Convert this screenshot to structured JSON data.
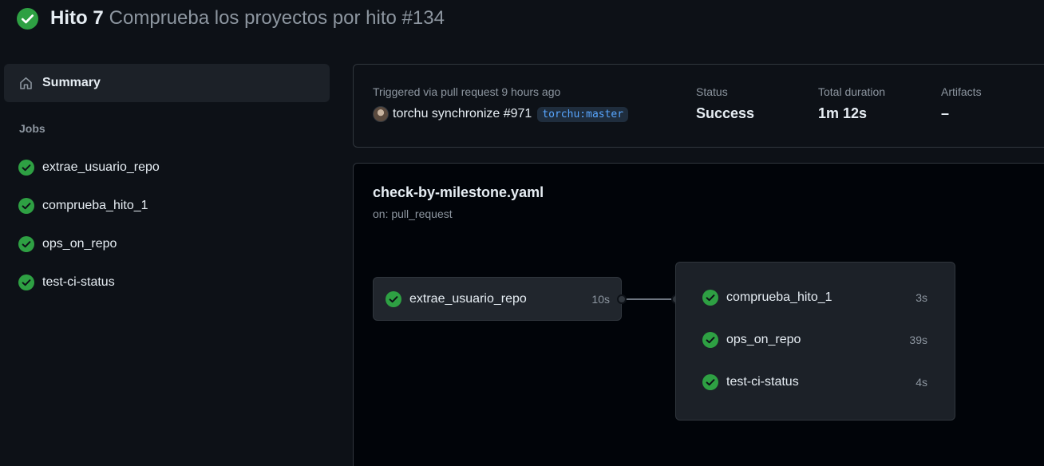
{
  "header": {
    "run_name": "Hito 7",
    "run_subtitle": "Comprueba los proyectos por hito #134",
    "status_icon": "check-circle-fill-icon",
    "success_color": "#2ea043"
  },
  "sidebar": {
    "summary_label": "Summary",
    "summary_icon": "home-icon",
    "jobs_heading": "Jobs",
    "jobs": [
      {
        "label": "extrae_usuario_repo",
        "status": "success"
      },
      {
        "label": "comprueba_hito_1",
        "status": "success"
      },
      {
        "label": "ops_on_repo",
        "status": "success"
      },
      {
        "label": "test-ci-status",
        "status": "success"
      }
    ]
  },
  "summary": {
    "trigger_label": "Triggered via pull request 9 hours ago",
    "trigger_text": "torchu synchronize #971",
    "branch": "torchu:master",
    "status_label": "Status",
    "status_value": "Success",
    "duration_label": "Total duration",
    "duration_value": "1m 12s",
    "artifacts_label": "Artifacts",
    "artifacts_value": "–"
  },
  "workflow": {
    "file": "check-by-milestone.yaml",
    "trigger": "on: pull_request",
    "first_job": {
      "name": "extrae_usuario_repo",
      "duration": "10s"
    },
    "group_jobs": [
      {
        "name": "comprueba_hito_1",
        "duration": "3s"
      },
      {
        "name": "ops_on_repo",
        "duration": "39s"
      },
      {
        "name": "test-ci-status",
        "duration": "4s"
      }
    ]
  }
}
